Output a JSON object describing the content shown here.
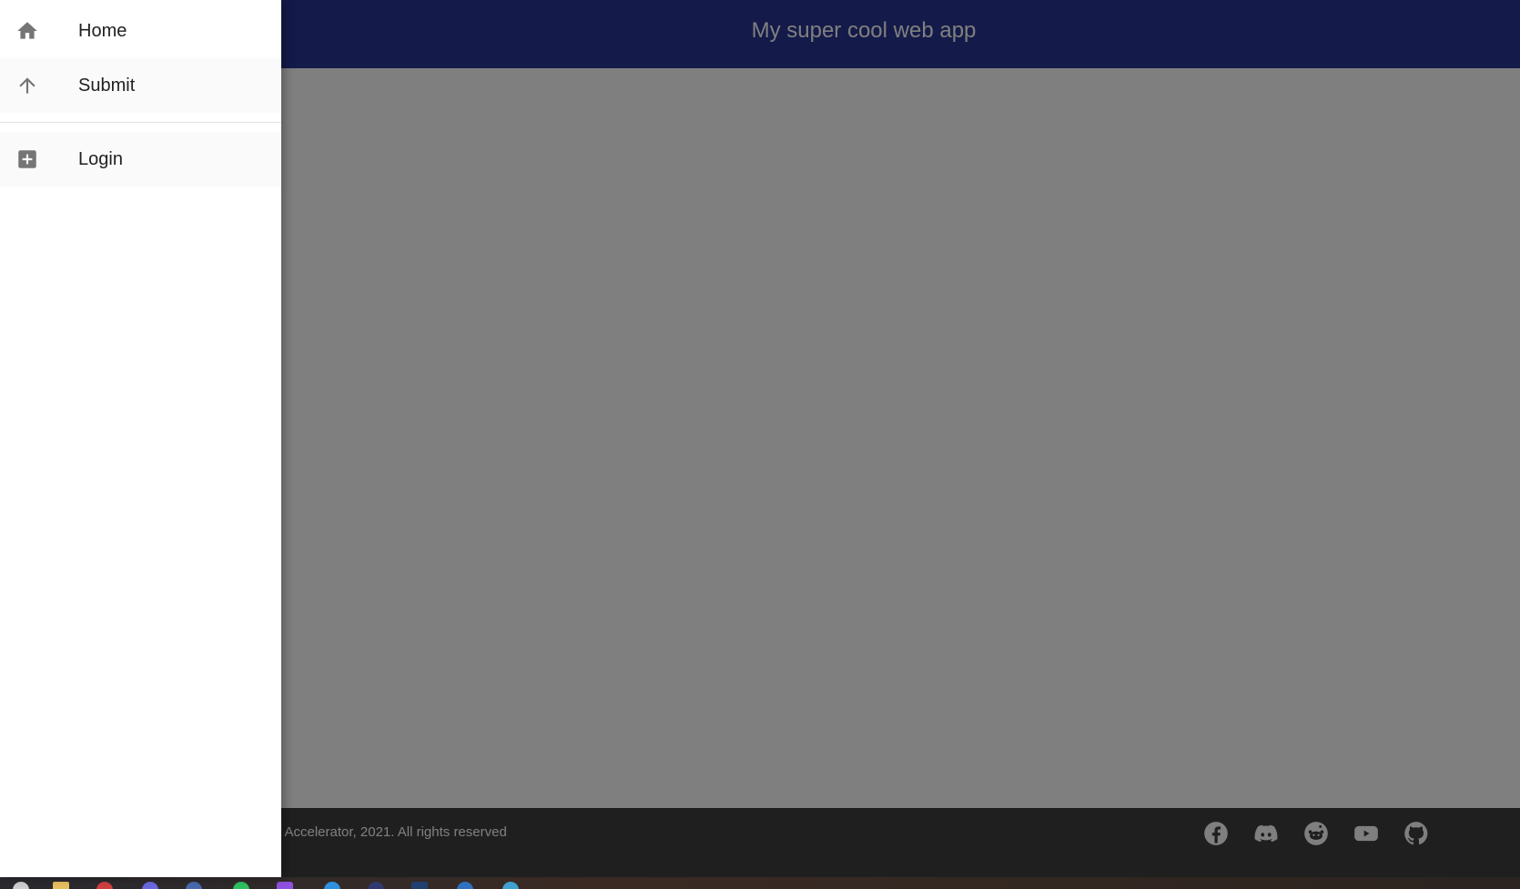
{
  "app": {
    "title": "My super cool web app"
  },
  "drawer": {
    "items": [
      {
        "label": "Home",
        "icon": "home-icon"
      },
      {
        "label": "Submit",
        "icon": "arrow-up-icon"
      },
      {
        "label": "Login",
        "icon": "plus-box-icon"
      }
    ]
  },
  "footer": {
    "copyright": ": Accelerator, 2021. All rights reserved",
    "social": [
      {
        "name": "facebook-icon"
      },
      {
        "name": "discord-icon"
      },
      {
        "name": "reddit-icon"
      },
      {
        "name": "youtube-icon"
      },
      {
        "name": "github-icon"
      }
    ]
  },
  "colors": {
    "appbar": "#283593",
    "footer": "#3f3f3f",
    "drawer": "#ffffff",
    "scrim": "rgba(0,0,0,0.5)"
  }
}
